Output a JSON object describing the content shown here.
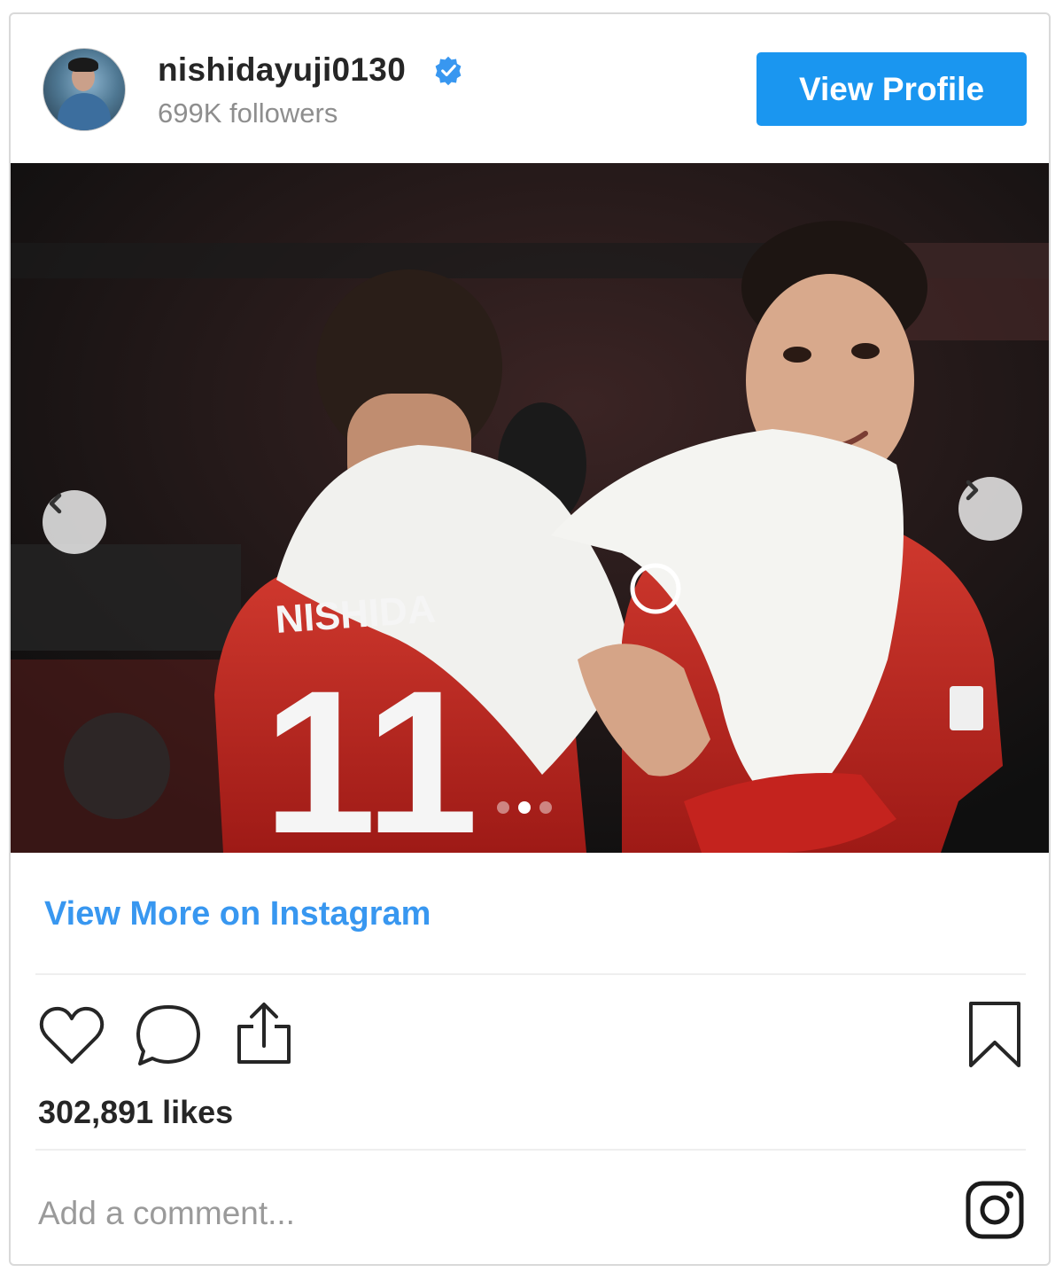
{
  "header": {
    "username": "nishidayuji0130",
    "verified": true,
    "followers": "699K followers",
    "view_profile_label": "View Profile"
  },
  "post": {
    "image_text": {
      "jersey_name": "NISHIDA",
      "jersey_number": "11"
    },
    "carousel": {
      "slide_count": 3,
      "active_slide": 2
    },
    "view_more_label": "View More on Instagram",
    "likes": "302,891 likes",
    "comment_placeholder": "Add a comment..."
  },
  "icons": {
    "like": "heart-icon",
    "comment": "comment-bubble-icon",
    "share": "share-icon",
    "save": "bookmark-icon",
    "instagram": "instagram-logo-icon",
    "prev": "chevron-left-icon",
    "next": "chevron-right-icon",
    "verified": "verified-badge-icon"
  },
  "colors": {
    "accent": "#1a96f0",
    "link": "#3897f0",
    "verified": "#3897f0",
    "text": "#262626",
    "muted": "#8e8e8e",
    "jersey": "#c4231e"
  }
}
